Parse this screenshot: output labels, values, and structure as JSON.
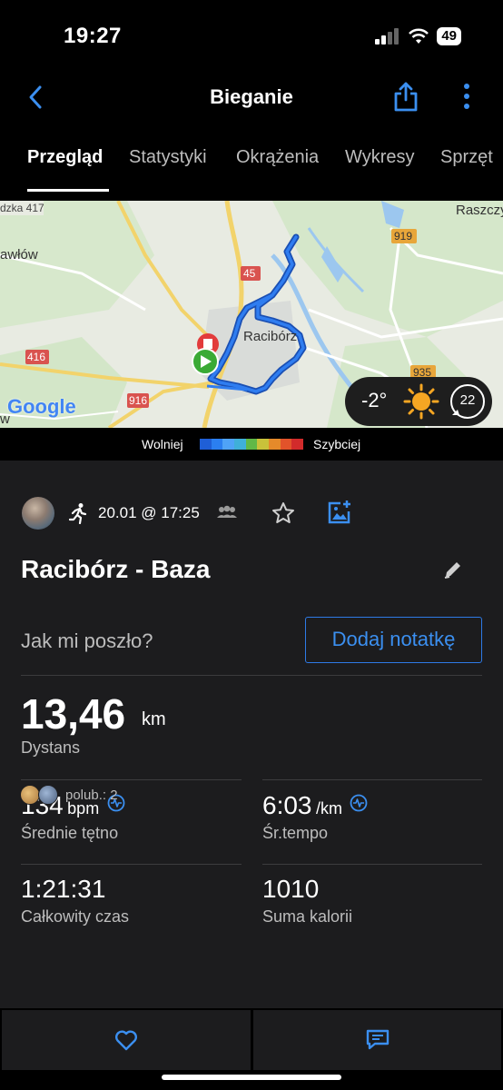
{
  "status_bar": {
    "time": "19:27",
    "battery": "49"
  },
  "header": {
    "title": "Bieganie"
  },
  "tabs": [
    {
      "label": "Przegląd"
    },
    {
      "label": "Statystyki"
    },
    {
      "label": "Okrążenia"
    },
    {
      "label": "Wykresy"
    },
    {
      "label": "Sprzęt"
    }
  ],
  "map": {
    "city_label": "Racibórz",
    "road_labels": [
      "dzka 417",
      "45",
      "416",
      "916",
      "919",
      "935"
    ],
    "place_labels": [
      "awłów",
      "Raszczy",
      "w"
    ],
    "provider": "Google",
    "weather": {
      "temperature": "-2°",
      "wind": "22"
    }
  },
  "pace_legend": {
    "slow_label": "Wolniej",
    "fast_label": "Szybciej",
    "colors": [
      "#1f5fd6",
      "#2b7ff0",
      "#4fa3f7",
      "#3fb0d9",
      "#61b847",
      "#c9c23a",
      "#e58a2a",
      "#e2532a",
      "#d22b2b"
    ]
  },
  "activity": {
    "date": "20.01 @ 17:25",
    "title": "Racibórz - Baza",
    "question": "Jak mi poszło?",
    "note_button": "Dodaj notatkę"
  },
  "stats": {
    "distance": {
      "value": "13,46",
      "unit": "km",
      "label": "Dystans"
    },
    "heart_rate": {
      "value": "134",
      "unit": "bpm",
      "label": "Średnie tętno"
    },
    "pace": {
      "value": "6:03",
      "unit": "/km",
      "label": "Śr.tempo"
    },
    "total_time": {
      "value": "1:21:31",
      "label": "Całkowity czas"
    },
    "calories": {
      "value": "1010",
      "label": "Suma kalorii"
    }
  },
  "likes": {
    "text": "polub.: 2"
  },
  "colors": {
    "accent": "#3b8ff0",
    "background": "#1c1c1e",
    "route": "#2266dd"
  }
}
